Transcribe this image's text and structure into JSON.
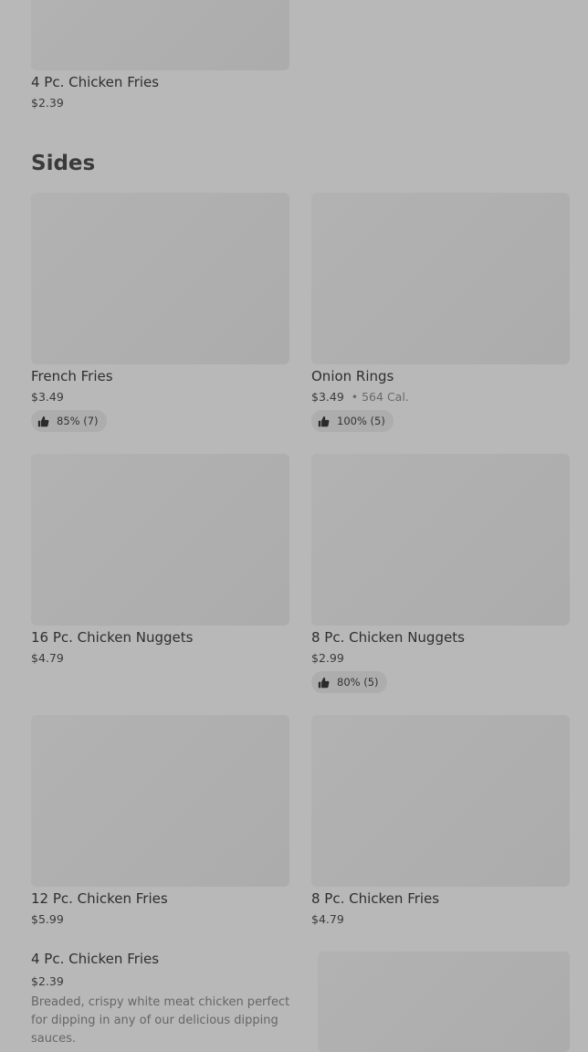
{
  "top_item": {
    "name": "4 Pc. Chicken Fries",
    "price": "$2.39"
  },
  "section": {
    "title": "Sides"
  },
  "items": [
    {
      "name": "French Fries",
      "price": "$3.49",
      "rating": "85% (7)"
    },
    {
      "name": "Onion Rings",
      "price": "$3.49",
      "calories": "564 Cal.",
      "rating": "100% (5)"
    },
    {
      "name": "16 Pc. Chicken Nuggets",
      "price": "$4.79"
    },
    {
      "name": "8 Pc. Chicken Nuggets",
      "price": "$2.99",
      "rating": "80% (5)"
    },
    {
      "name": "12 Pc. Chicken Fries",
      "price": "$5.99"
    },
    {
      "name": "8 Pc. Chicken Fries",
      "price": "$4.79"
    }
  ],
  "featured_item": {
    "name": "4 Pc. Chicken Fries",
    "price": "$2.39",
    "description": "Breaded, crispy white meat chicken perfect for dipping in any of our delicious dipping sauces."
  },
  "icons": {
    "rating": "thumbs-up-icon"
  },
  "colors": {
    "overlay_background": "#b8b8b8"
  }
}
